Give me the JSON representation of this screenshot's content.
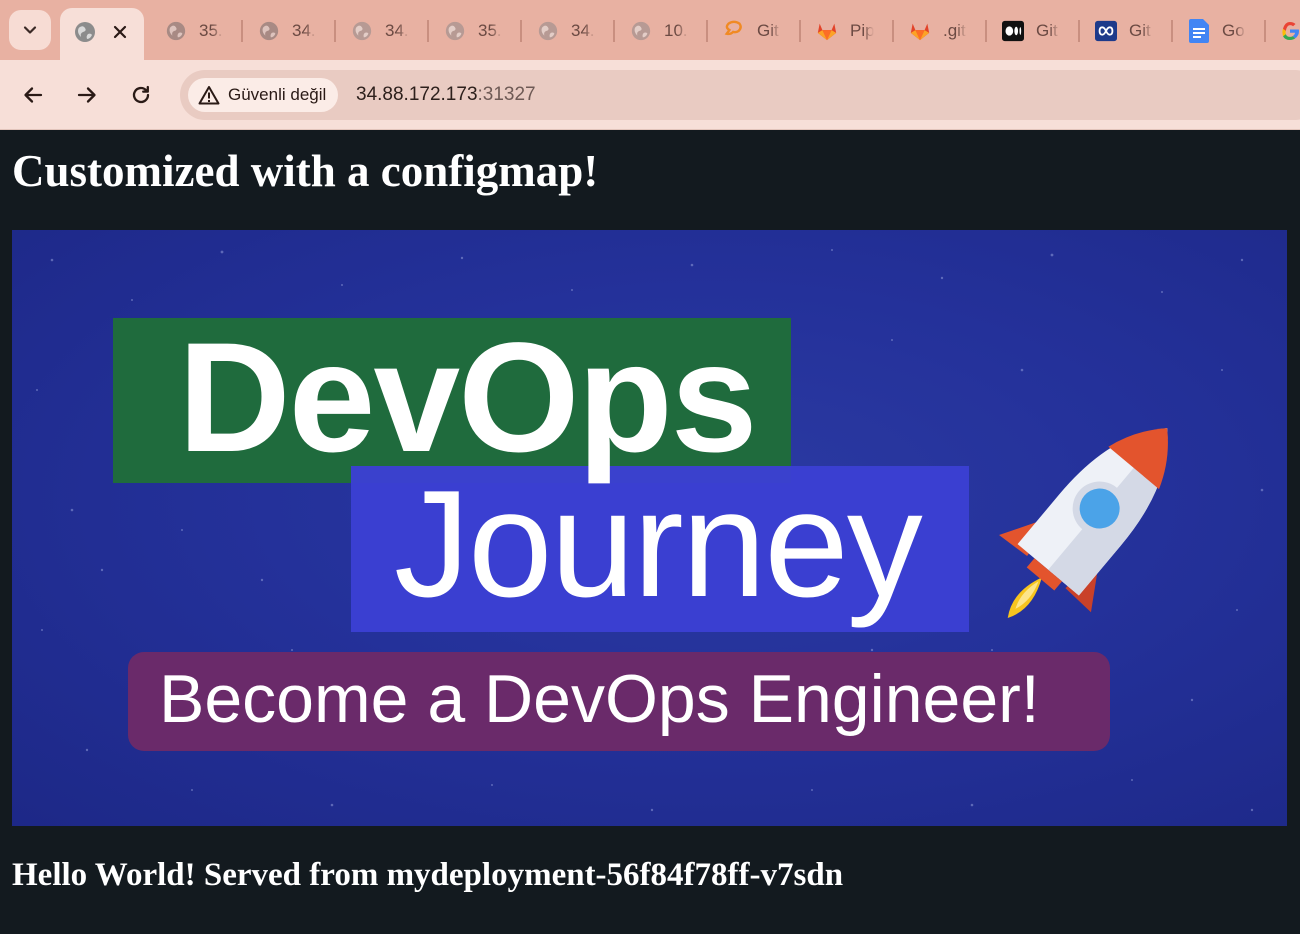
{
  "browser": {
    "active_tab": {
      "icon": "globe-icon"
    },
    "tabs": [
      {
        "label": "35.",
        "icon": "globe-icon"
      },
      {
        "label": "34.",
        "icon": "globe-icon"
      },
      {
        "label": "34.",
        "icon": "globe-icon"
      },
      {
        "label": "35.",
        "icon": "globe-icon"
      },
      {
        "label": "34.",
        "icon": "globe-icon"
      },
      {
        "label": "10.",
        "icon": "globe-icon"
      },
      {
        "label": "Git",
        "icon": "git-logo-icon"
      },
      {
        "label": "Pip",
        "icon": "gitlab-icon"
      },
      {
        "label": ".git",
        "icon": "gitlab-icon"
      },
      {
        "label": "Git",
        "icon": "medium-icon"
      },
      {
        "label": "Git",
        "icon": "infinity-icon"
      },
      {
        "label": "Go",
        "icon": "google-docs-icon"
      }
    ],
    "security_label": "Güvenli değil",
    "url_host": "34.88.172.173",
    "url_port": ":31327"
  },
  "page": {
    "heading": "Customized with a configmap!",
    "banner": {
      "line1": "DevOps",
      "line2": "Journey",
      "tagline": "Become a DevOps Engineer!"
    },
    "footer": "Hello World! Served from mydeployment-56f84f78ff-v7sdn"
  },
  "colors": {
    "tabstrip": "#e8b1a2",
    "toolbar": "#f7dfd8",
    "page_background": "#131a1f",
    "banner_background": "#24319a",
    "banner_green": "#1f6b3d",
    "banner_blue": "#3b3fd3",
    "banner_purple": "#6a2a6a"
  }
}
